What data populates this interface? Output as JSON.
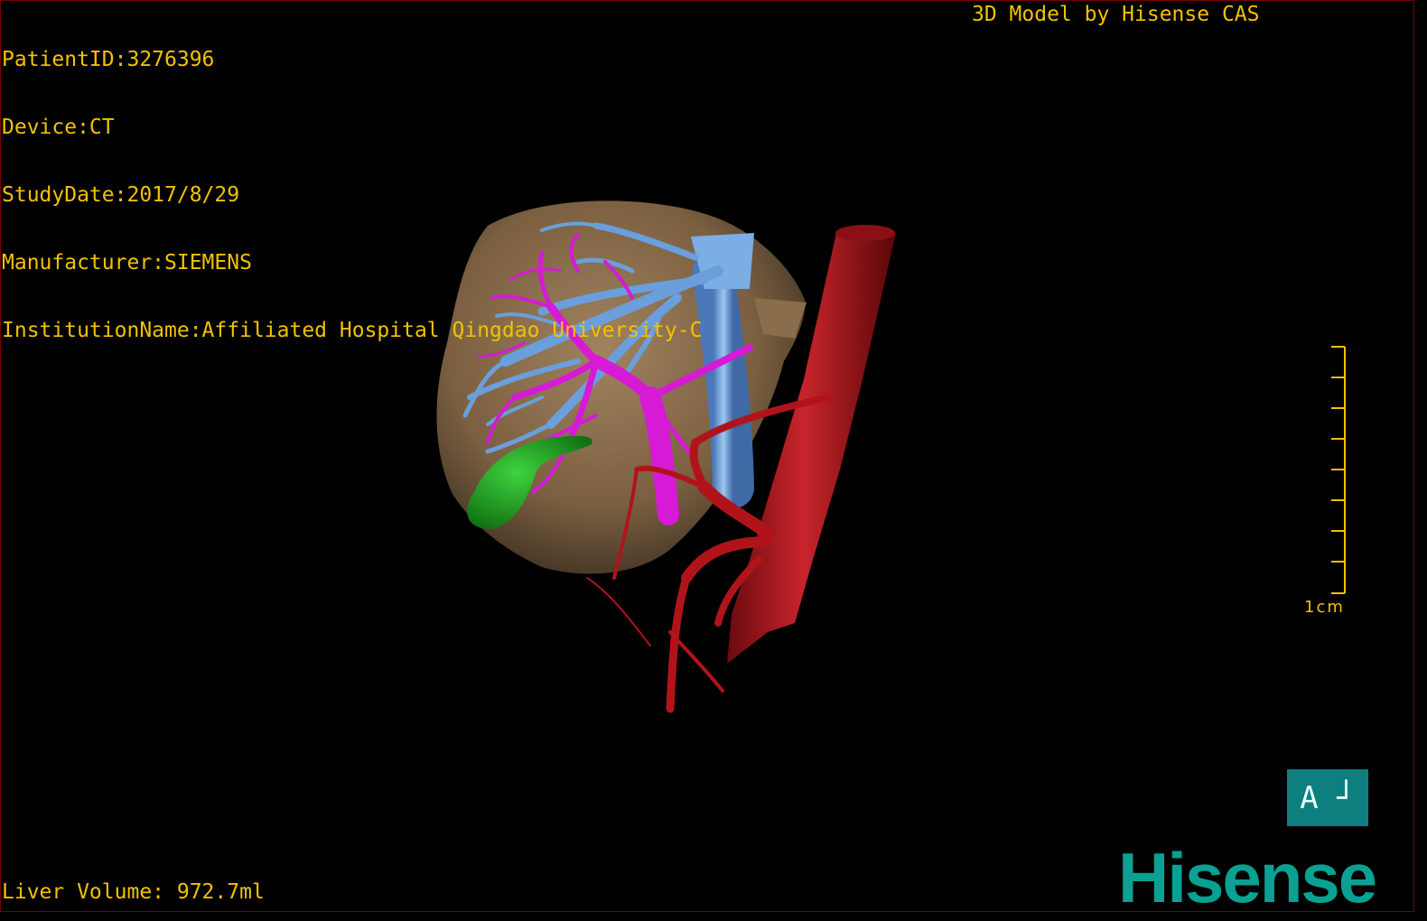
{
  "overlay": {
    "patient_id": "PatientID:3276396",
    "device": "Device:CT",
    "study_date": "StudyDate:2017/8/29",
    "manufacturer": "Manufacturer:SIEMENS",
    "institution": "InstitutionName:Affiliated Hospital Qingdao University-C",
    "model_credit": "3D Model by Hisense CAS",
    "liver_volume": "Liver Volume: 972.7ml"
  },
  "scale_bar": {
    "label": "1cm"
  },
  "orientation_cube": {
    "label": "A ┘"
  },
  "branding": {
    "logo_text": "Hisense"
  },
  "colors": {
    "text": "#f2c200",
    "liver": "#8a6d4a",
    "portal_vein": "#d61ad6",
    "hepatic_vein": "#6a9fdc",
    "artery_aorta": "#b0141a",
    "gallbladder": "#1f9e1f",
    "orientation_bg": "#0d7f7f",
    "logo": "#0aa193"
  },
  "render_labels": {
    "liver": "liver",
    "hepatic_vein": "hepatic vein / IVC",
    "portal_vein": "portal vein",
    "aorta": "aorta and arterial branches",
    "gallbladder": "gallbladder"
  }
}
